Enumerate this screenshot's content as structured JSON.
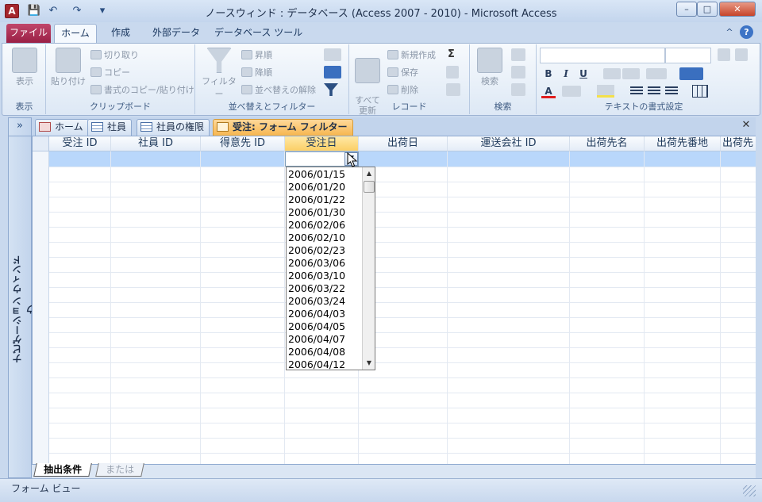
{
  "window": {
    "title": "ノースウィンド : データベース (Access 2007 - 2010)  -  Microsoft Access",
    "app_icon": "A",
    "controls": {
      "minimize": "–",
      "maximize": "□",
      "close": "✕"
    }
  },
  "quick_access": {
    "save": "💾",
    "undo": "↶",
    "redo": "↷",
    "customize": "▾"
  },
  "ribbon": {
    "tabs": [
      {
        "label": "ファイル"
      },
      {
        "label": "ホーム"
      },
      {
        "label": "作成"
      },
      {
        "label": "外部データ"
      },
      {
        "label": "データベース ツール"
      }
    ],
    "help": "?",
    "collapse": "^",
    "groups": {
      "view": {
        "label": "表示",
        "view_button": "表示"
      },
      "clipboard": {
        "label": "クリップボード",
        "paste": "貼り付け",
        "cut": "切り取り",
        "copy": "コピー",
        "format_painter": "書式のコピー/貼り付け"
      },
      "sort_filter": {
        "label": "並べ替えとフィルター",
        "filter": "フィルター",
        "ascending": "昇順",
        "descending": "降順",
        "remove_sort": "並べ替えの解除"
      },
      "records": {
        "label": "レコード",
        "refresh_all": "すべて\n更新",
        "new": "新規作成",
        "save": "保存",
        "delete": "削除"
      },
      "find": {
        "label": "検索",
        "find": "検索"
      },
      "text_format": {
        "label": "テキストの書式設定",
        "bold": "B",
        "italic": "I",
        "underline": "U",
        "font_color": "A"
      }
    }
  },
  "nav_pane": {
    "toggle": "»",
    "label": "ナビゲーション ウィンドウ"
  },
  "document_tabs": [
    {
      "label": "ホーム"
    },
    {
      "label": "社員"
    },
    {
      "label": "社員の権限"
    },
    {
      "label": "受注: フォーム フィルター"
    }
  ],
  "doc_close": "✕",
  "grid": {
    "columns": [
      "受注 ID",
      "社員 ID",
      "得意先 ID",
      "受注日",
      "出荷日",
      "運送会社 ID",
      "出荷先名",
      "出荷先番地",
      "出荷先"
    ],
    "dropdown_arrow": "▼"
  },
  "dropdown": {
    "items": [
      "2006/01/15",
      "2006/01/20",
      "2006/01/22",
      "2006/01/30",
      "2006/02/06",
      "2006/02/10",
      "2006/02/23",
      "2006/03/06",
      "2006/03/10",
      "2006/03/22",
      "2006/03/24",
      "2006/04/03",
      "2006/04/05",
      "2006/04/07",
      "2006/04/08",
      "2006/04/12"
    ],
    "scroll_up": "▲",
    "scroll_down": "▼"
  },
  "bottom_tabs": [
    {
      "label": "抽出条件"
    },
    {
      "label": "または"
    }
  ],
  "status": {
    "text": "フォーム ビュー"
  }
}
